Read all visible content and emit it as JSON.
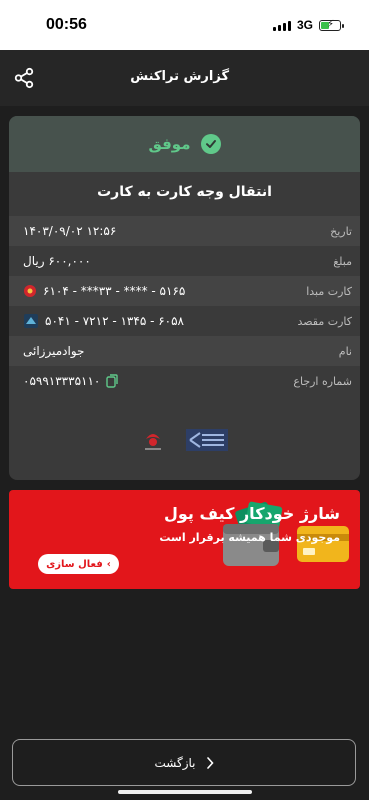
{
  "status_bar": {
    "time": "00:56",
    "network": "3G"
  },
  "header": {
    "title": "گزارش تراکنش"
  },
  "transaction": {
    "status": "موفق",
    "title": "انتقال وجه کارت به کارت",
    "rows": [
      {
        "label": "تاریخ",
        "value": "۱۴۰۳/۰۹/۰۲ ۱۲:۵۶"
      },
      {
        "label": "مبلغ",
        "value": "۶۰۰,۰۰۰ ریال"
      },
      {
        "label": "کارت مبدا",
        "value": "۶۱۰۴ - ***۳۳ - **** - ۵۱۶۵"
      },
      {
        "label": "کارت مقصد",
        "value": "۵۰۴۱ - ۷۲۱۲ - ۱۳۴۵ - ۶۰۵۸"
      },
      {
        "label": "نام",
        "value": "جوادمیرزائی"
      },
      {
        "label": "شماره ارجاع",
        "value": "۰۵۹۹۱۳۳۳۵۱۱۰"
      }
    ]
  },
  "banner": {
    "title": "شارژ خودکار کیف پول",
    "subtitle": "موجودی شما همیشه برقرار است",
    "button": "فعال سازی"
  },
  "footer": {
    "back_label": "بازگشت"
  },
  "colors": {
    "success": "#60c98a",
    "banner": "#e2161b",
    "background": "#1e1e1e"
  }
}
